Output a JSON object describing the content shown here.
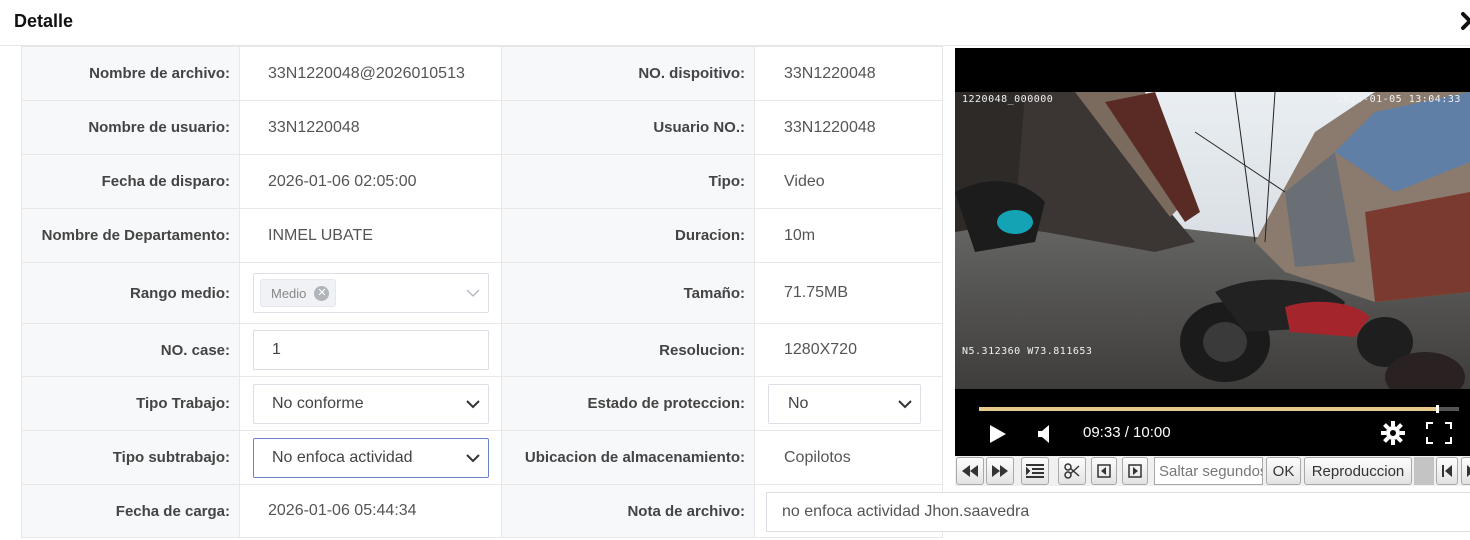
{
  "header": {
    "title": "Detalle"
  },
  "rows": [
    {
      "l1": "Nombre de archivo:",
      "v1": "33N1220048@2026010513",
      "l2": "NO. dispoitivo:",
      "v2": "33N1220048"
    },
    {
      "l1": "Nombre de usuario:",
      "v1": "33N1220048",
      "l2": "Usuario NO.:",
      "v2": "33N1220048"
    },
    {
      "l1": "Fecha de disparo:",
      "v1": "2026-01-06 02:05:00",
      "l2": "Tipo:",
      "v2": "Video"
    },
    {
      "l1": "Nombre de Departamento:",
      "v1": "INMEL UBATE",
      "l2": "Duracion:",
      "v2": "10m"
    },
    {
      "l1": "Rango medio:",
      "tag": "Medio",
      "l2": "Tamaño:",
      "v2": "71.75MB"
    },
    {
      "l1": "NO. case:",
      "input": "1",
      "l2": "Resolucion:",
      "v2": "1280X720"
    },
    {
      "l1": "Tipo Trabajo:",
      "select": "No conforme",
      "l2": "Estado de proteccion:",
      "select2": "No"
    },
    {
      "l1": "Tipo subtrabajo:",
      "select": "No enfoca actividad",
      "l2": "Ubicacion de almacenamiento:",
      "v2": "Copilotos"
    },
    {
      "l1": "Fecha de carga:",
      "v1": "2026-01-06 05:44:34",
      "l2": "Nota de archivo:",
      "note": "no enfoca actividad Jhon.saavedra"
    }
  ],
  "video": {
    "osd_device": "1220048_000000",
    "osd_datetime": "2026-01-05 13:04:33",
    "osd_gps": "N5.312360  W73.811653",
    "time_display": "09:33 / 10:00",
    "progress_fraction": 0.955
  },
  "toolbar": {
    "seek_placeholder": "Saltar segundos",
    "ok_label": "OK",
    "playback_label": "Reproduccion"
  },
  "colors": {
    "accent_progress": "#e5c98d",
    "focus_border": "#6b82c9",
    "label_bg": "#f7f8fa"
  }
}
